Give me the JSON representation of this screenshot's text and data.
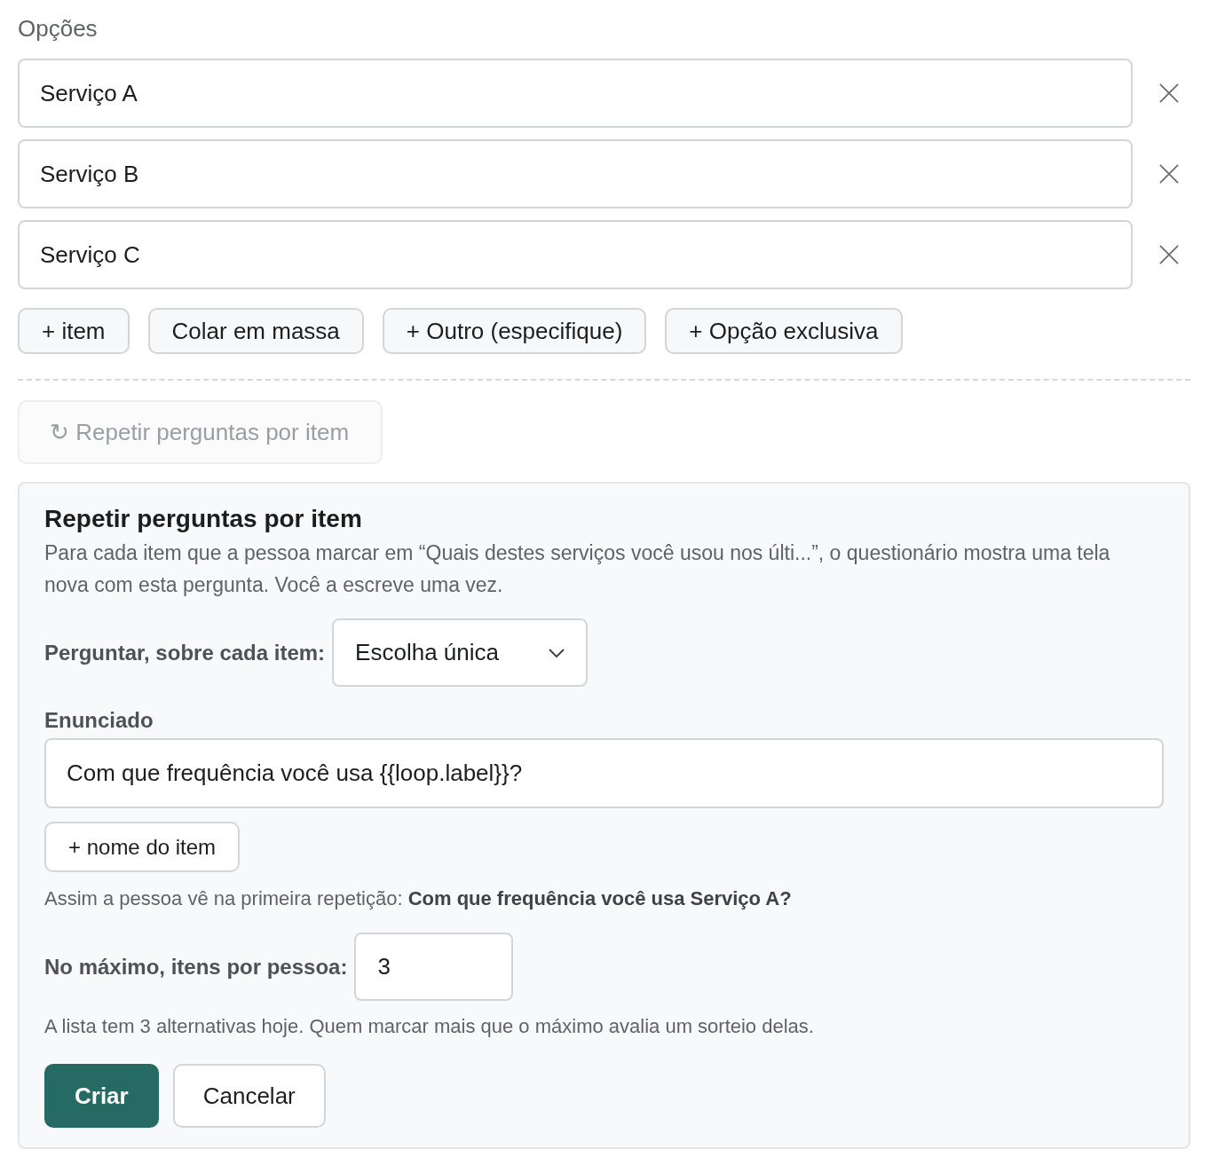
{
  "options_section": {
    "title": "Opções",
    "options": [
      {
        "value": "Serviço A"
      },
      {
        "value": "Serviço B"
      },
      {
        "value": "Serviço C"
      }
    ]
  },
  "option_actions": [
    {
      "label": "+ item"
    },
    {
      "label": "Colar em massa"
    },
    {
      "label": "+ Outro (especifique)"
    },
    {
      "label": "+ Opção exclusiva"
    }
  ],
  "repeat_toggle": {
    "icon": "↻",
    "label": "Repetir perguntas por item",
    "disabled": true
  },
  "repeat_panel": {
    "title": "Repetir perguntas por item",
    "description": "Para cada item que a pessoa marcar em “Quais destes serviços você usou nos últi...”, o questionário mostra uma tela nova com esta pergunta. Você a escreve uma vez.",
    "ask_label": "Perguntar, sobre cada item:",
    "ask_select": {
      "value": "Escolha única"
    },
    "statement_label": "Enunciado",
    "statement_input": {
      "value": "Com que frequência você usa {{loop.label}}?"
    },
    "insert_button": "+ nome do item",
    "preview": "Assim a pessoa vê na primeira repetição: **Com que frequência você usa Serviço A?**",
    "max_label": "No máximo, itens por pessoa:",
    "max_input": {
      "value": "3"
    },
    "note": "A lista tem 3 alternativas hoje. Quem marcar mais que o máximo avalia um sorteio delas.",
    "buttons": [
      {
        "label": "Criar",
        "kind": "primary"
      },
      {
        "label": "Cancelar",
        "kind": "secondary"
      }
    ]
  }
}
